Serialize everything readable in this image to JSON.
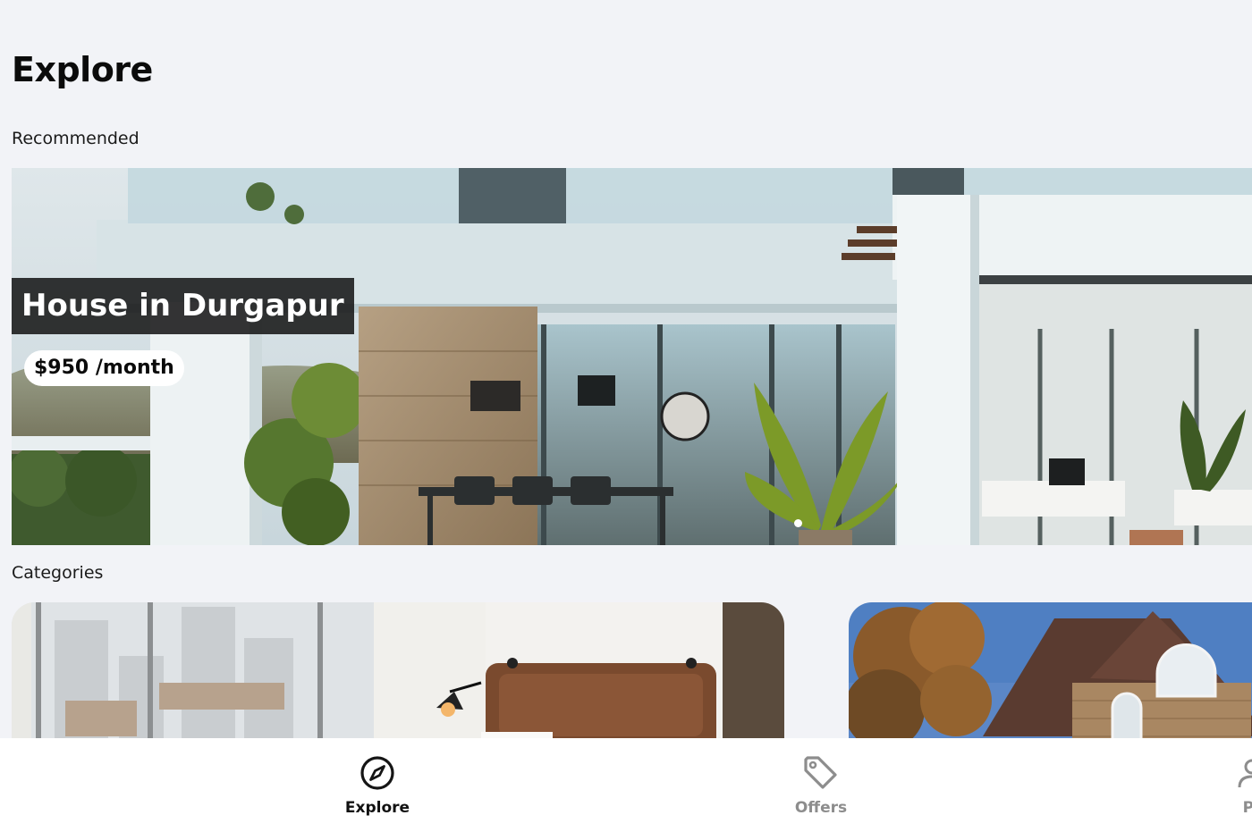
{
  "header": {
    "title": "Explore"
  },
  "sections": {
    "recommended": "Recommended",
    "categories": "Categories"
  },
  "recommended": {
    "title": "House in Durgapur",
    "price": "$950 /month",
    "active_slide": 1,
    "slide_count": 2
  },
  "category_cards": [
    {
      "image": "bedroom-photo"
    },
    {
      "image": "brick-house-photo"
    }
  ],
  "bottom_nav": {
    "items": [
      {
        "label": "Explore",
        "icon": "compass-icon",
        "active": true
      },
      {
        "label": "Offers",
        "icon": "tag-icon",
        "active": false
      },
      {
        "label": "Pr",
        "icon": "profile-icon",
        "active": false
      }
    ]
  },
  "colors": {
    "background": "#f2f3f7",
    "active_nav": "#111111",
    "inactive_nav": "#8d8d8d"
  }
}
